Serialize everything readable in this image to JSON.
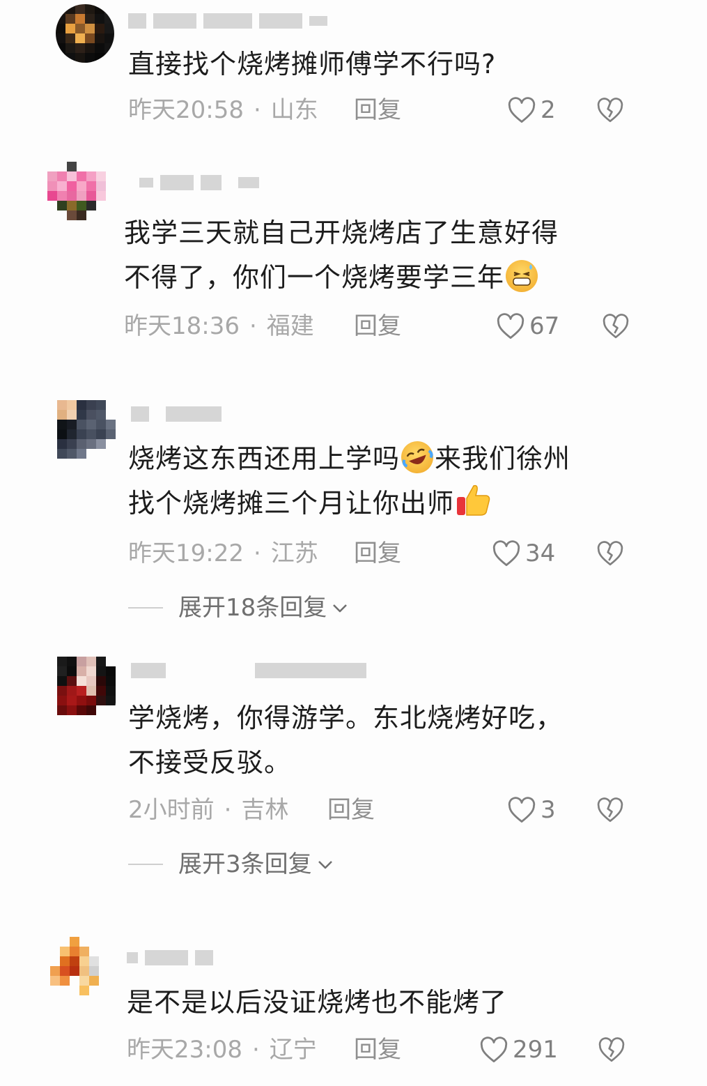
{
  "comments": [
    {
      "text": "直接找个烧烤摊师傅学不行吗?",
      "time": "昨天20:58",
      "location": "山东",
      "reply_label": "回复",
      "likes": "2"
    },
    {
      "text": "我学三天就自己开烧烤店了生意好得\n不得了，你们一个烧烤要学三年",
      "emoji": "grinning-sweat-emoji",
      "time": "昨天18:36",
      "location": "福建",
      "reply_label": "回复",
      "likes": "67"
    },
    {
      "text_a": "烧烤这东西还用上学吗",
      "emoji_a": "rolling-laughing-emoji",
      "text_b": "来我们徐州",
      "text_c": "找个烧烤摊三个月让你出师",
      "emoji_c": "thumbs-up-emoji",
      "time": "昨天19:22",
      "location": "江苏",
      "reply_label": "回复",
      "likes": "34",
      "expand_label": "展开18条回复"
    },
    {
      "text": "学烧烤，你得游学。东北烧烤好吃，\n不接受反驳。",
      "time": "2小时前",
      "location": "吉林",
      "reply_label": "回复",
      "likes": "3",
      "expand_label": "展开3条回复"
    },
    {
      "text": "是不是以后没证烧烤也不能烤了",
      "time": "昨天23:08",
      "location": "辽宁",
      "reply_label": "回复",
      "likes": "291"
    }
  ],
  "meta_separator": "·",
  "icons": {
    "like": "heart-outline-icon",
    "dislike": "broken-heart-icon",
    "expand": "chevron-down-icon"
  },
  "colors": {
    "text": "#1c1c1c",
    "meta": "#a8a8a8",
    "background": "#fdfdfd"
  }
}
